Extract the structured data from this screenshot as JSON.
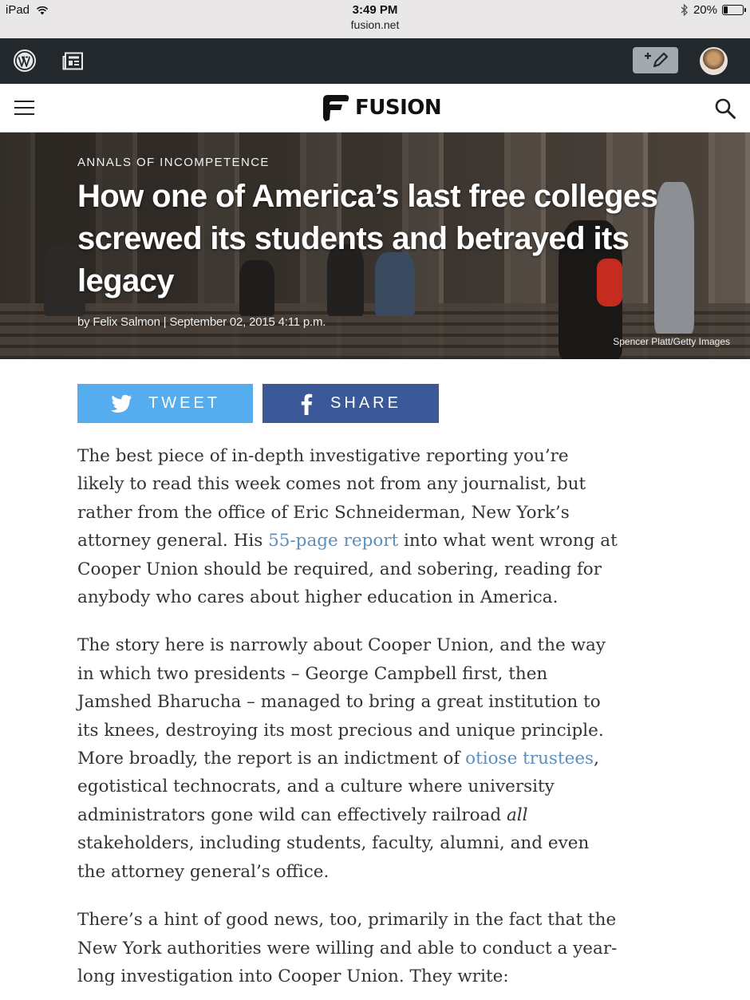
{
  "status_bar": {
    "device": "iPad",
    "time": "3:49 PM",
    "url": "fusion.net",
    "battery": "20%",
    "battery_level": 0.2
  },
  "admin_bar": {
    "icons": [
      "wordpress-icon",
      "reader-icon",
      "write-post-icon",
      "avatar"
    ]
  },
  "site_header": {
    "brand": "FUSION",
    "icons": [
      "menu-icon",
      "search-icon"
    ]
  },
  "hero": {
    "kicker": "ANNALS OF INCOMPETENCE",
    "title": "How one of America’s last free colleges screwed its students and betrayed its legacy",
    "byline": "by Felix Salmon | September 02, 2015 4:11 p.m.",
    "credit": "Spencer Platt/Getty Images"
  },
  "share": {
    "tweet_label": "TWEET",
    "share_label": "SHARE",
    "tweet_color": "#55acee",
    "share_color": "#3b5998"
  },
  "article": {
    "link_color": "#5b8fbe",
    "p1": {
      "before": "The best piece of in-depth investigative reporting you’re likely to read this week comes not from any journalist, but rather from the office of Eric Schneiderman, New York’s attorney general. His ",
      "link": "55-page report",
      "after": " into what went wrong at Cooper Union should be required, and sobering, reading for anybody who cares about higher education in America."
    },
    "p2": {
      "before": "The story here is narrowly about Cooper Union, and the way in which two presidents – George Campbell first, then Jamshed Bharucha – managed to bring a great institution to its knees, destroying its most precious and unique principle. More broadly, the report is an indictment of ",
      "link": "otiose trustees",
      "middle": ", egotistical technocrats, and a culture where university administrators gone wild can effectively railroad ",
      "emphasis": "all",
      "after": " stakeholders, including students, faculty, alumni, and even the attorney general’s office."
    },
    "p3": "There’s a hint of good news, too, primarily in the fact that the New York authorities were willing and able to conduct a year-long investigation into Cooper Union. They write:"
  }
}
